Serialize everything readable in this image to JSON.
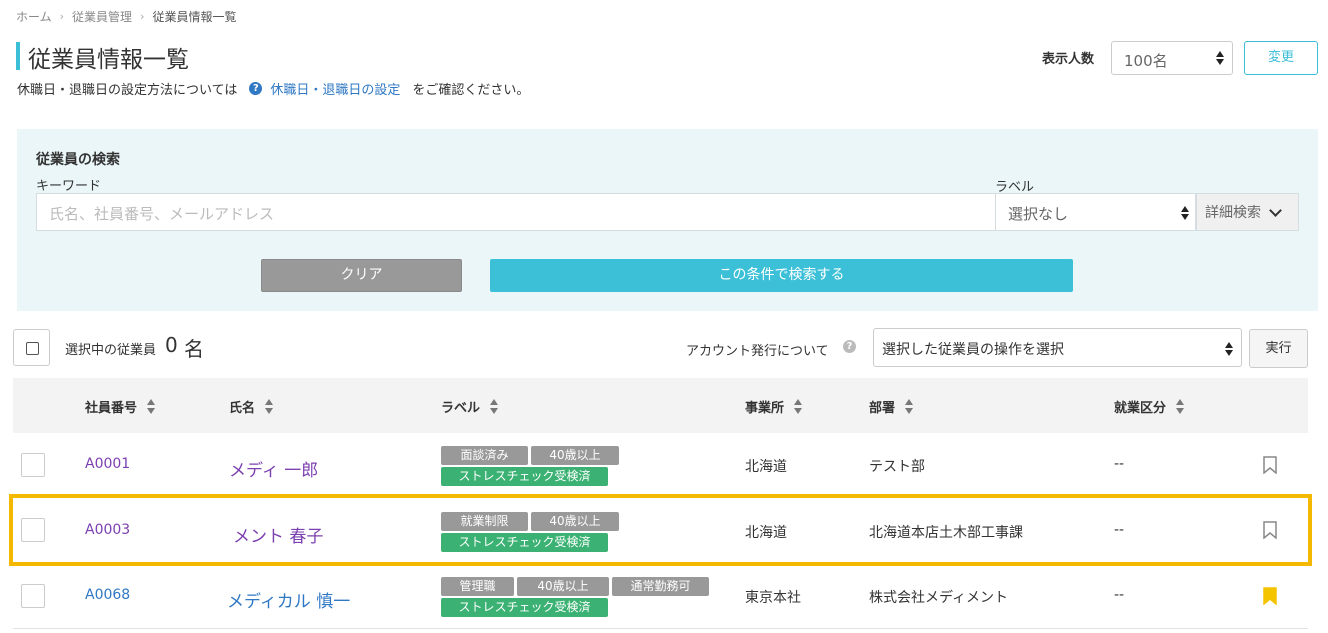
{
  "breadcrumb": [
    "ホーム",
    "従業員管理",
    "従業員情報一覧"
  ],
  "page_title": "従業員情報一覧",
  "info": {
    "before": "休職日・退職日の設定方法については",
    "link": "休職日・退職日の設定",
    "after": "をご確認ください。"
  },
  "display": {
    "label": "表示人数",
    "value": "100名",
    "change_label": "変更"
  },
  "search": {
    "title": "従業員の検索",
    "keyword_label": "キーワード",
    "keyword_placeholder": "氏名、社員番号、メールアドレス",
    "label_label": "ラベル",
    "label_value": "選択なし",
    "detail_label": "詳細検索",
    "clear_label": "クリア",
    "submit_label": "この条件で検索する"
  },
  "selection": {
    "text": "選択中の従業員",
    "count": "0",
    "unit": "名",
    "account_text": "アカウント発行について",
    "operation_value": "選択した従業員の操作を選択",
    "exec_label": "実行"
  },
  "table": {
    "columns": [
      "社員番号",
      "氏名",
      "ラベル",
      "事業所",
      "部署",
      "就業区分"
    ],
    "rows": [
      {
        "id": "A0001",
        "name": "メディ 一郎",
        "tags": [
          "面談済み",
          "40歳以上"
        ],
        "tag_green": "ストレスチェック受検済",
        "office": "北海道",
        "dept": "テスト部",
        "type": "--",
        "bookmarked": false,
        "id_color": "#7b3fb0",
        "name_color": "#7b3fb0"
      },
      {
        "id": "A0003",
        "name": "メント 春子",
        "tags": [
          "就業制限",
          "40歳以上"
        ],
        "tag_green": "ストレスチェック受検済",
        "office": "北海道",
        "dept": "北海道本店土木部工事課",
        "type": "--",
        "bookmarked": false,
        "id_color": "#7b3fb0",
        "name_color": "#7b3fb0"
      },
      {
        "id": "A0068",
        "name": "メディカル 慎一",
        "tags": [
          "管理職",
          "40歳以上",
          "通常勤務可"
        ],
        "tag_green": "ストレスチェック受検済",
        "office": "東京本社",
        "dept": "株式会社メディメント",
        "type": "--",
        "bookmarked": true,
        "id_color": "#2f78c4",
        "name_color": "#2f78c4"
      }
    ]
  },
  "colors": {
    "accent": "#3bbfd6",
    "link": "#2f78c4",
    "visited": "#7b3fb0",
    "tag_gray": "#999999",
    "tag_green": "#3bb273",
    "bookmark_active": "#f5c400",
    "highlight": "#f5b800"
  }
}
